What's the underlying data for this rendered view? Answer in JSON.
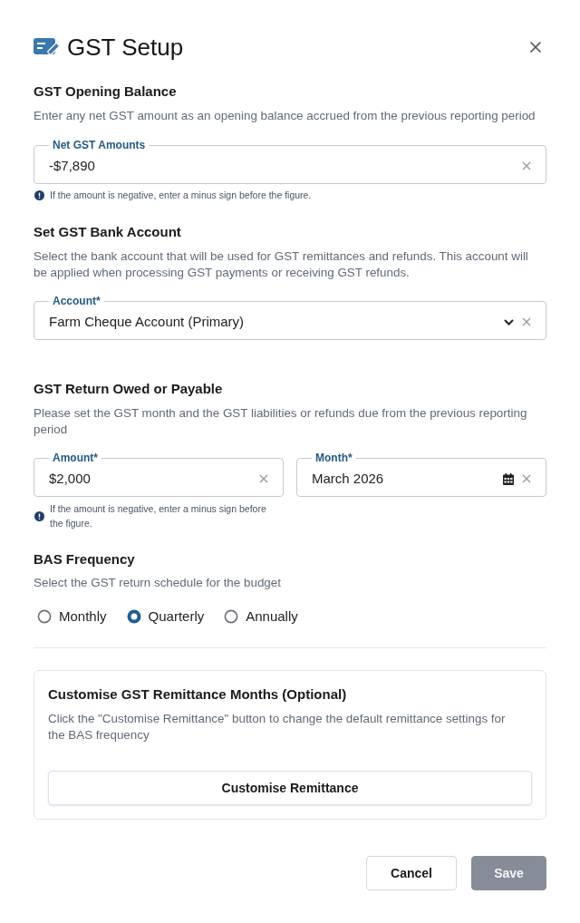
{
  "dialog": {
    "title": "GST Setup"
  },
  "opening_balance": {
    "heading": "GST Opening Balance",
    "description": "Enter any net GST amount as an opening balance accrued from the previous reporting period",
    "field": {
      "kind": "text",
      "label": "Net GST Amounts",
      "value": "-$7,890"
    },
    "hint": "If the amount is negative, enter a minus sign before the figure."
  },
  "bank_account": {
    "heading": "Set GST Bank Account",
    "description": "Select the bank account that will be used for GST remittances and refunds. This account will be applied when processing GST payments or receiving GST refunds.",
    "field": {
      "kind": "select",
      "label": "Account*",
      "value": "Farm Cheque Account (Primary)"
    }
  },
  "return_owed": {
    "heading": "GST Return Owed or Payable",
    "description": "Please set the GST month and the GST liabilities or refunds due from the previous reporting period",
    "fields": [
      {
        "kind": "text",
        "label": "Amount*",
        "value": "$2,000",
        "hint": "If the amount is negative, enter a minus sign before the figure."
      },
      {
        "kind": "date",
        "label": "Month*",
        "value": "March 2026"
      }
    ]
  },
  "bas_frequency": {
    "heading": "BAS Frequency",
    "description": "Select the GST return schedule for the budget",
    "options": [
      {
        "label": "Monthly",
        "selected": false
      },
      {
        "label": "Quarterly",
        "selected": true
      },
      {
        "label": "Annually",
        "selected": false
      }
    ]
  },
  "remittance": {
    "heading": "Customise GST Remittance Months (Optional)",
    "description": "Click the \"Customise Remittance\" button to change the default remittance settings for the BAS frequency",
    "button": "Customise Remittance"
  },
  "footer": {
    "buttons": [
      {
        "label": "Cancel",
        "kind": "secondary",
        "disabled": false
      },
      {
        "label": "Save",
        "kind": "primary",
        "disabled": true
      }
    ]
  }
}
